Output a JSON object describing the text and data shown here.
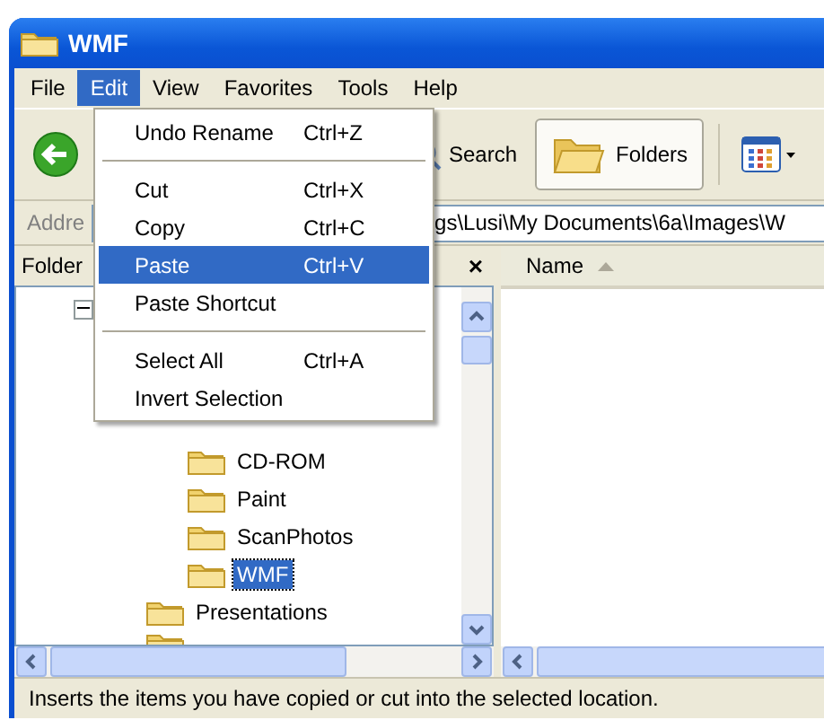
{
  "window": {
    "title": "WMF"
  },
  "menu_bar": [
    {
      "label": "File",
      "selected": false
    },
    {
      "label": "Edit",
      "selected": true
    },
    {
      "label": "View",
      "selected": false
    },
    {
      "label": "Favorites",
      "selected": false
    },
    {
      "label": "Tools",
      "selected": false
    },
    {
      "label": "Help",
      "selected": false
    }
  ],
  "toolbar": {
    "search": "Search",
    "folders": {
      "label": "Folders",
      "pressed": true
    }
  },
  "address": {
    "label": "Addre",
    "value": "gs\\Lusi\\My Documents\\6a\\Images\\W"
  },
  "folders_pane": {
    "title": "Folder",
    "close": "×",
    "tree": [
      {
        "expanded": true,
        "children": [
          {
            "children": [
              {
                "label": "CD-ROM",
                "selected": false
              },
              {
                "label": "Paint",
                "selected": false
              },
              {
                "label": "ScanPhotos",
                "selected": false
              },
              {
                "label": "WMF",
                "selected": true
              }
            ]
          },
          {
            "label": "Presentations",
            "selected": false
          },
          {
            "kind": "cut_off"
          }
        ]
      }
    ]
  },
  "file_list": {
    "columns": [
      {
        "label": "Name",
        "sort_ascending": true
      }
    ]
  },
  "edit_menu": [
    {
      "kind": "item",
      "label": "Undo Rename",
      "shortcut": "Ctrl+Z",
      "selected": false
    },
    {
      "kind": "separator"
    },
    {
      "kind": "item",
      "label": "Cut",
      "shortcut": "Ctrl+X",
      "selected": false
    },
    {
      "kind": "item",
      "label": "Copy",
      "shortcut": "Ctrl+C",
      "selected": false
    },
    {
      "kind": "item",
      "label": "Paste",
      "shortcut": "Ctrl+V",
      "selected": true
    },
    {
      "kind": "item",
      "label": "Paste Shortcut",
      "selected": false
    },
    {
      "kind": "separator"
    },
    {
      "kind": "item",
      "label": "Select All",
      "shortcut": "Ctrl+A",
      "selected": false
    },
    {
      "kind": "item",
      "label": "Invert Selection",
      "selected": false
    }
  ],
  "status_bar": "Inserts the items you have copied or cut into the selected location."
}
